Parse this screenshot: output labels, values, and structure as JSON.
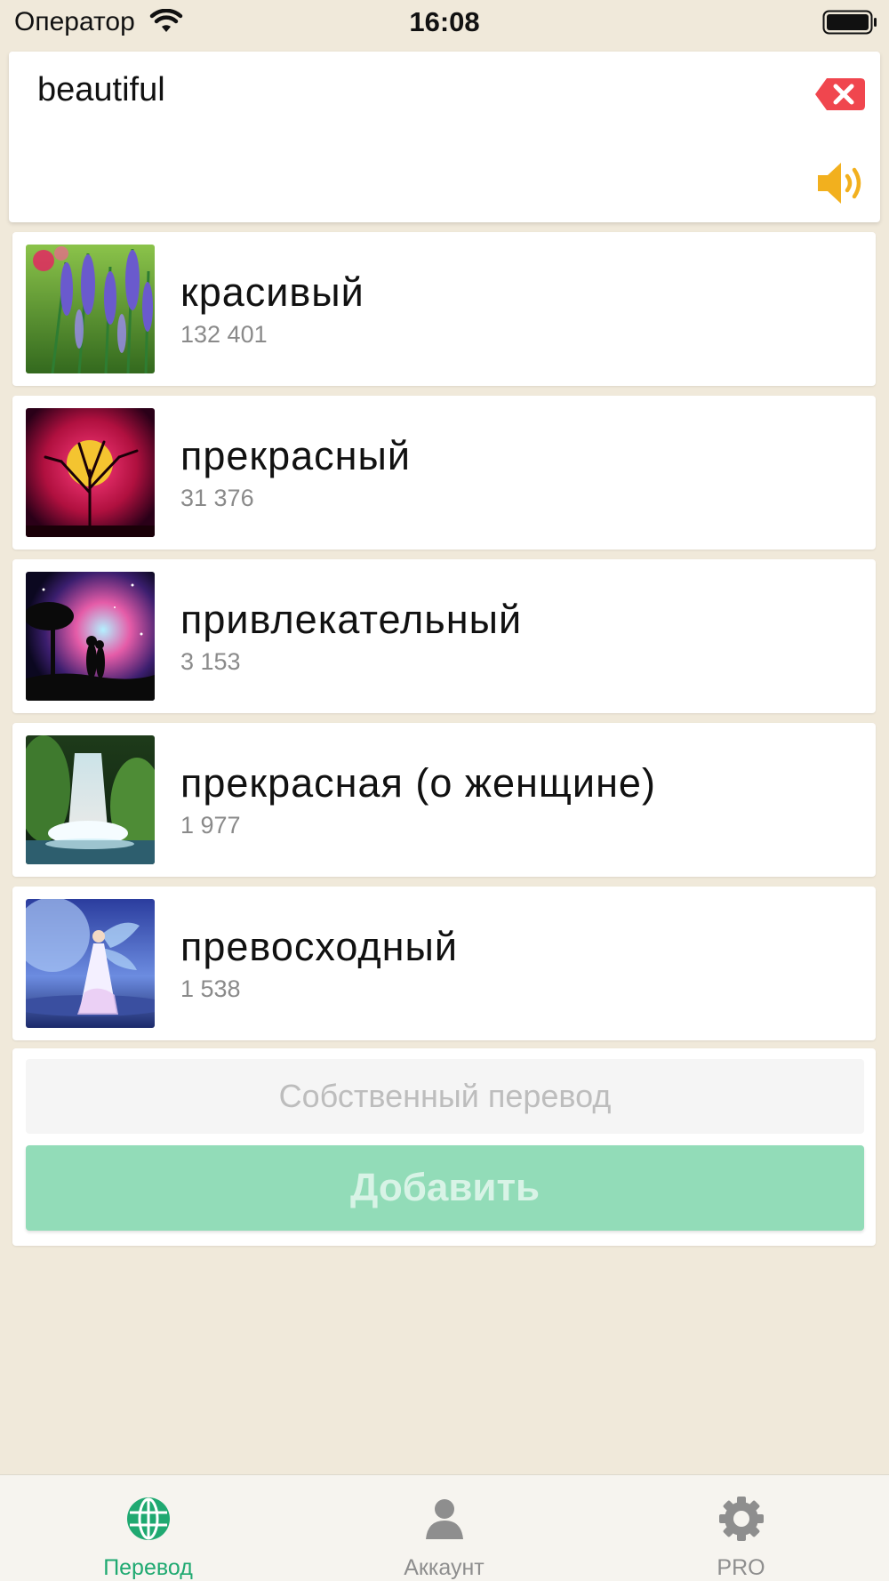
{
  "status_bar": {
    "carrier": "Оператор",
    "time": "16:08"
  },
  "search": {
    "query": "beautiful",
    "clear_icon": "clear-icon",
    "speaker_icon": "speaker-icon"
  },
  "translations": [
    {
      "word": "красивый",
      "count": "132 401",
      "thumb": "lavender-flowers"
    },
    {
      "word": "прекрасный",
      "count": "31 376",
      "thumb": "moon-tree-silhouette"
    },
    {
      "word": "привлекательный",
      "count": "3 153",
      "thumb": "couple-galaxy"
    },
    {
      "word": "прекрасная (о женщине)",
      "count": "1 977",
      "thumb": "waterfall"
    },
    {
      "word": "превосходный",
      "count": "1 538",
      "thumb": "fairy-moon"
    }
  ],
  "custom": {
    "placeholder": "Собственный перевод",
    "add_label": "Добавить"
  },
  "tabs": [
    {
      "label": "Перевод",
      "icon": "globe-icon",
      "active": true
    },
    {
      "label": "Аккаунт",
      "icon": "user-icon",
      "active": false
    },
    {
      "label": "PRO",
      "icon": "gear-icon",
      "active": false
    }
  ],
  "colors": {
    "background": "#F0E9DA",
    "accent": "#1FA971",
    "add_button": "#92DCB8",
    "clear": "#F0464E",
    "speaker": "#F2B01E"
  }
}
